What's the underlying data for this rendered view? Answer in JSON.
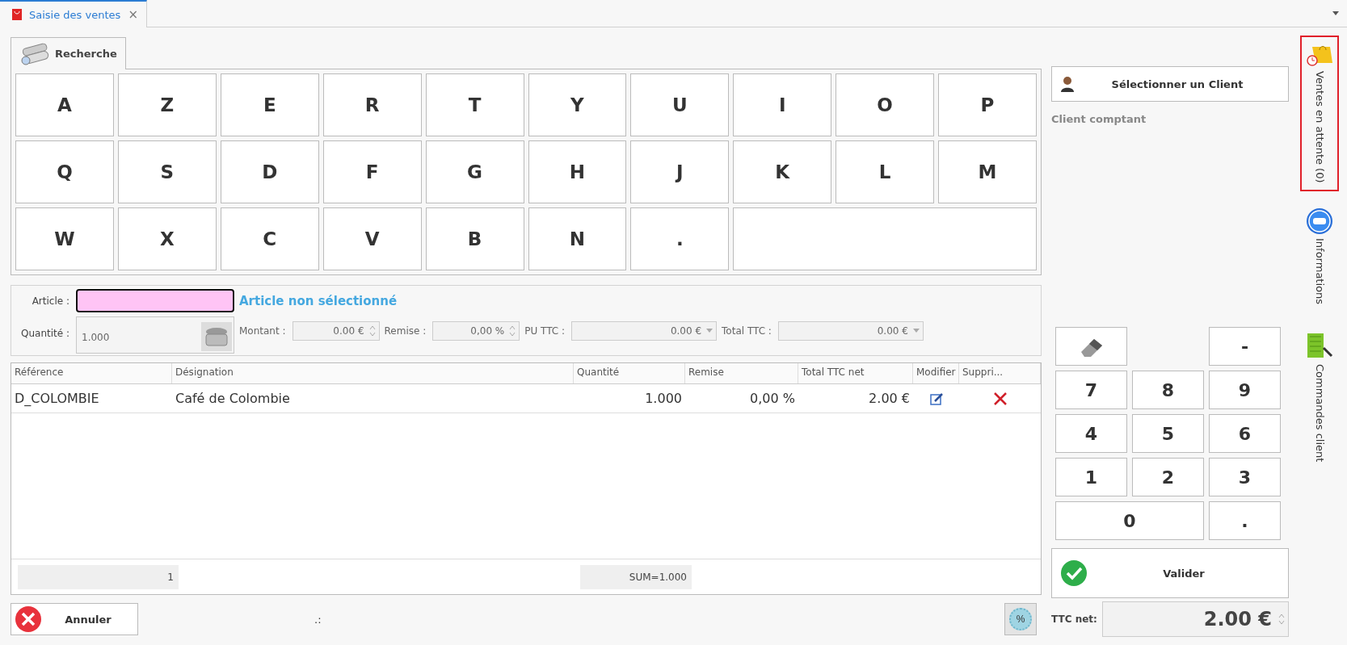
{
  "document_tab": {
    "title": "Saisie des ventes",
    "close": "×",
    "selected": true
  },
  "keyboard": {
    "tab": "Recherche",
    "keys": [
      "A",
      "Z",
      "E",
      "R",
      "T",
      "Y",
      "U",
      "I",
      "O",
      "P",
      "Q",
      "S",
      "D",
      "F",
      "G",
      "H",
      "J",
      "K",
      "L",
      "M",
      "W",
      "X",
      "C",
      "V",
      "B",
      "N",
      "."
    ]
  },
  "article": {
    "label": "Article :",
    "status": "Article non sélectionné",
    "quantity_label": "Quantité :",
    "quantity_value": "1.000"
  },
  "amounts": [
    {
      "label": "Montant :",
      "value": "0.00 €",
      "kind": "spin"
    },
    {
      "label": "Remise :",
      "value": "0,00 %",
      "kind": "spin"
    },
    {
      "label": "PU TTC :",
      "value": "0.00 €",
      "kind": "dropdown"
    },
    {
      "label": "Total TTC :",
      "value": "0.00 €",
      "kind": "dropdown"
    }
  ],
  "table": {
    "columns": [
      "Référence",
      "Désignation",
      "Quantité",
      "Remise",
      "Total TTC net",
      "Modifier",
      "Suppri..."
    ],
    "rows": [
      {
        "reference": "D_COLOMBIE",
        "designation": "Café de Colombie",
        "quantity": "1.000",
        "discount": "0,00 %",
        "total": "2.00 €"
      }
    ],
    "footer": {
      "count": "1",
      "sum": "SUM=1.000"
    }
  },
  "cancel_button": "Annuler",
  "status_text": ".:",
  "discount_button": "%",
  "client": {
    "button": "Sélectionner un Client",
    "name": "Client comptant"
  },
  "numpad": [
    {
      "kind": "eraser"
    },
    {
      "kind": "far",
      "label": "-"
    },
    {
      "kind": "key",
      "label": "7"
    },
    {
      "kind": "key",
      "label": "8"
    },
    {
      "kind": "key",
      "label": "9"
    },
    {
      "kind": "key",
      "label": "4"
    },
    {
      "kind": "key",
      "label": "5"
    },
    {
      "kind": "key",
      "label": "6"
    },
    {
      "kind": "key",
      "label": "1"
    },
    {
      "kind": "key",
      "label": "2"
    },
    {
      "kind": "key",
      "label": "3"
    },
    {
      "kind": "wide",
      "label": "0"
    },
    {
      "kind": "key",
      "label": "."
    }
  ],
  "validate_button": "Valider",
  "total": {
    "label": "TTC net:",
    "value": "2.00 €"
  },
  "side_tabs": [
    {
      "label": "Ventes en attente (0)",
      "kind": "pending",
      "selected": true
    },
    {
      "label": "Informations",
      "kind": "info",
      "selected": false
    },
    {
      "label": "Commandes client",
      "kind": "orders",
      "selected": false
    }
  ]
}
